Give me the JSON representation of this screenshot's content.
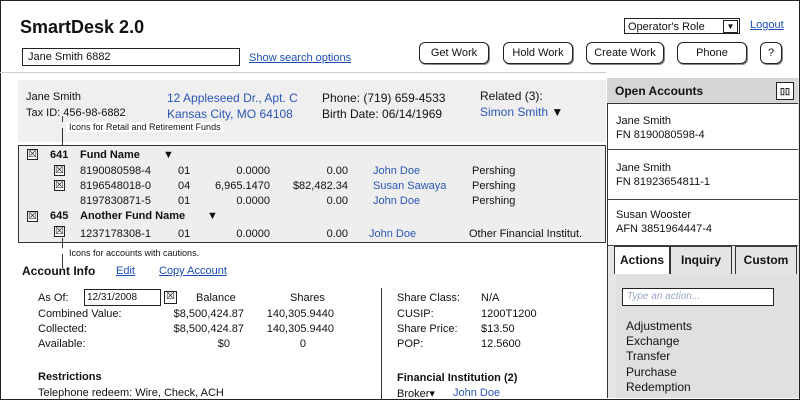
{
  "app": {
    "title": "SmartDesk 2.0"
  },
  "header": {
    "role_label": "Operator's Role",
    "role_dropdown": "▼",
    "logout": "Logout",
    "search_value": "Jane Smith 6882",
    "show_search": "Show search options",
    "buttons": {
      "get_work": "Get Work",
      "hold_work": "Hold Work",
      "create_work": "Create Work",
      "phone": "Phone",
      "help": "?"
    }
  },
  "customer": {
    "name": "Jane Smith",
    "tax_id": "Tax ID: 456-98-6882",
    "address1": "12 Appleseed Dr., Apt. C",
    "address2": "Kansas City, MO 64108",
    "phone": "Phone: (719) 659-4533",
    "birth": "Birth Date: 06/14/1969",
    "related_label": "Related (3):",
    "related_name": "Simon Smith",
    "related_arrow": "▼"
  },
  "tooltips": {
    "retail": "Icons for Retail and Retirement Funds",
    "cautions": "Icons for accounts with cautions."
  },
  "funds": [
    {
      "number": "641",
      "name": "Fund Name",
      "arrow": "▼",
      "rows": [
        {
          "acct": "8190080598-4",
          "code": "01",
          "shares": "0.0000",
          "value": "0.00",
          "rep": "John Doe",
          "inst": "Pershing"
        },
        {
          "acct": "8196548018-0",
          "code": "04",
          "shares": "6,965.1470",
          "value": "$82,482.34",
          "rep": "Susan Sawaya",
          "inst": "Pershing"
        },
        {
          "acct": "8197830871-5",
          "code": "01",
          "shares": "0.0000",
          "value": "0.00",
          "rep": "John Doe",
          "inst": "Pershing"
        }
      ]
    },
    {
      "number": "645",
      "name": "Another Fund Name",
      "arrow": "▼",
      "rows": [
        {
          "acct": "1237178308-1",
          "code": "01",
          "shares": "0.0000",
          "value": "0.00",
          "rep": "John Doe",
          "inst": "Other Financial Institut."
        }
      ]
    }
  ],
  "checkbox_mark": "☒",
  "account_info": {
    "title": "Account Info",
    "edit": "Edit",
    "copy": "Copy Account",
    "as_of_label": "As Of:",
    "as_of_value": "12/31/2008",
    "col_balance": "Balance",
    "col_shares": "Shares",
    "rows": [
      {
        "label": "Combined Value:",
        "balance": "$8,500,424.87",
        "shares": "140,305.9440"
      },
      {
        "label": "Collected:",
        "balance": "$8,500,424.87",
        "shares": "140,305.9440"
      },
      {
        "label": "Available:",
        "balance": "$0",
        "shares": "0"
      }
    ],
    "restrictions_title": "Restrictions",
    "restrictions_line": "Telephone redeem: Wire, Check, ACH"
  },
  "share_info": {
    "rows": [
      {
        "label": "Share Class:",
        "value": "N/A"
      },
      {
        "label": "CUSIP:",
        "value": "1200T1200"
      },
      {
        "label": "Share Price:",
        "value": "$13.50"
      },
      {
        "label": "POP:",
        "value": "12.5600"
      }
    ],
    "fi_title": "Financial Institution (2)",
    "broker_label": "Broker▾",
    "broker_name": "John Doe"
  },
  "sidebar": {
    "title": "Open Accounts",
    "expand": "▯▯",
    "accounts": [
      {
        "name": "Jane Smith",
        "number": "FN 8190080598-4"
      },
      {
        "name": "Jane Smith",
        "number": "FN 81923654811-1"
      },
      {
        "name": "Susan Wooster",
        "number": "AFN 3851964447-4"
      }
    ],
    "tabs": {
      "actions": "Actions",
      "inquiry": "Inquiry",
      "custom": "Custom"
    },
    "action_placeholder": "Type an action...",
    "actions": [
      "Adjustments",
      "Exchange",
      "Transfer",
      "Purchase",
      "Redemption"
    ]
  }
}
